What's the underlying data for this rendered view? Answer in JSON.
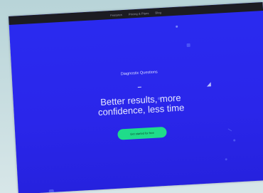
{
  "nav": {
    "links": [
      "Features",
      "Pricing & Plans",
      "Blog"
    ]
  },
  "hero": {
    "eyebrow": "Diagnostic Questions",
    "headline_line1": "Better results, more",
    "headline_line2": "confidence, less time",
    "cta_label": "Get started for free"
  },
  "colors": {
    "background": "#2a2bf0",
    "topbar": "#1c1c22",
    "cta": "#1fdc8a"
  }
}
